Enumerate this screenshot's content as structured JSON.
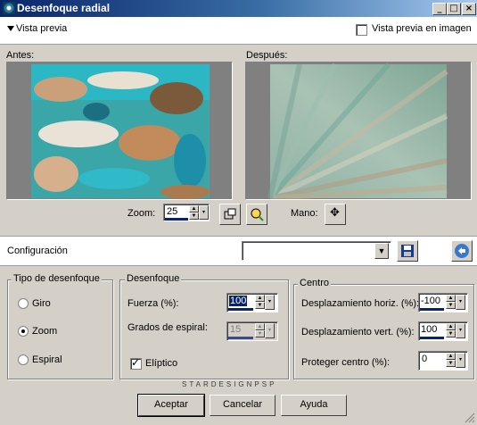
{
  "window": {
    "title": "Desenfoque radial",
    "minimize": "_",
    "maximize": "□",
    "close": "×"
  },
  "preview_header": {
    "toggle_label": "Vista previa",
    "in_image_label": "Vista previa en imagen",
    "in_image_checked": false
  },
  "before_label": "Antes:",
  "after_label": "Después:",
  "zoom": {
    "label": "Zoom:",
    "value": "25",
    "hand_label": "Mano:",
    "hand_icon": "move-icon"
  },
  "config": {
    "label": "Configuración",
    "value": ""
  },
  "blur_type": {
    "title": "Tipo de desenfoque",
    "options": [
      "Giro",
      "Zoom",
      "Espiral"
    ],
    "selected": "Zoom"
  },
  "blur": {
    "title": "Desenfoque",
    "strength_label": "Fuerza (%):",
    "strength_value": "100",
    "spiral_label": "Grados de espiral:",
    "spiral_value": "15",
    "elliptic_label": "Elíptico",
    "elliptic_checked": true
  },
  "center": {
    "title": "Centro",
    "hoff_label": "Desplazamiento horiz. (%):",
    "hoff_value": "-100",
    "voff_label": "Desplazamiento vert. (%):",
    "voff_value": "100",
    "protect_label": "Proteger centro (%):",
    "protect_value": "0"
  },
  "watermark": "STARDESIGNPSP",
  "buttons": {
    "ok": "Aceptar",
    "cancel": "Cancelar",
    "help": "Ayuda"
  },
  "colors": {
    "titlebar": "#0a246a",
    "dialog": "#d4d0c8"
  }
}
